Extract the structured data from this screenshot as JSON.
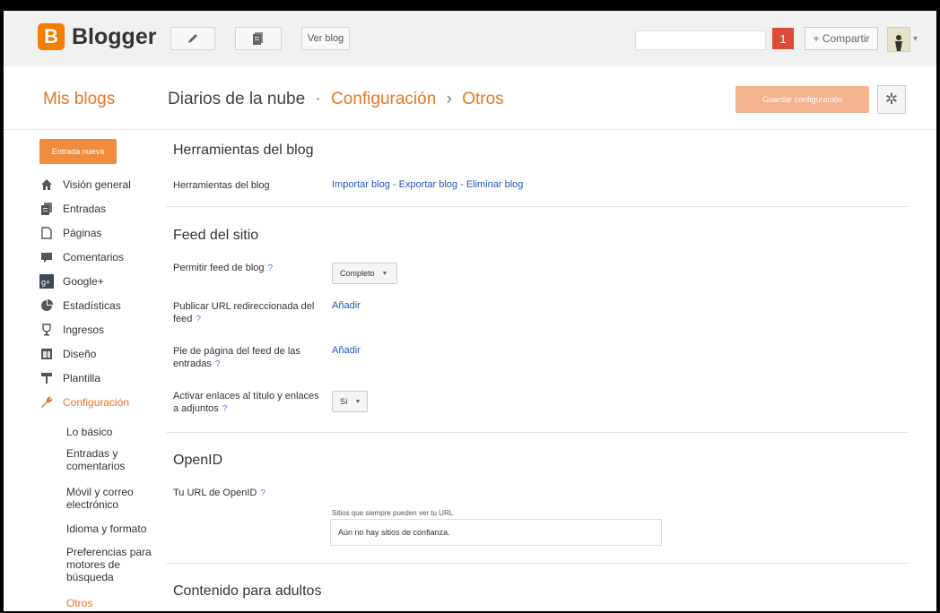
{
  "topbar": {
    "logo_letter": "B",
    "logo_text": "Blogger",
    "edit_icon": "pencil-icon",
    "pages_icon": "pages-icon",
    "view_blog": "Ver blog",
    "notification_count": "1",
    "share_label": "+ Compartir",
    "avatar_icon": "user-avatar-icon"
  },
  "header": {
    "my_blogs": "Mis blogs",
    "blog_name": "Diarios de la nube",
    "dot_sep": "·",
    "section": "Configuración",
    "arrow_sep": "›",
    "subsection": "Otros",
    "save_button": "Guardar configuración",
    "gear_icon": "gear-icon"
  },
  "sidebar": {
    "new_post": "Entrada nueva",
    "items": [
      {
        "label": "Visión general",
        "icon": "home-icon"
      },
      {
        "label": "Entradas",
        "icon": "posts-icon"
      },
      {
        "label": "Páginas",
        "icon": "page-icon"
      },
      {
        "label": "Comentarios",
        "icon": "comment-icon"
      },
      {
        "label": "Google+",
        "icon": "google-plus-icon"
      },
      {
        "label": "Estadísticas",
        "icon": "pie-chart-icon"
      },
      {
        "label": "Ingresos",
        "icon": "trophy-icon"
      },
      {
        "label": "Diseño",
        "icon": "layout-icon"
      },
      {
        "label": "Plantilla",
        "icon": "template-icon"
      },
      {
        "label": "Configuración",
        "icon": "wrench-icon",
        "active": true
      }
    ],
    "subitems": [
      {
        "label": "Lo básico"
      },
      {
        "label": "Entradas y comentarios"
      },
      {
        "label": "Móvil y correo electrónico"
      },
      {
        "label": "Idioma y formato"
      },
      {
        "label": "Preferencias para motores de búsqueda"
      },
      {
        "label": "Otros",
        "active": true
      }
    ]
  },
  "main": {
    "blog_tools": {
      "title": "Herramientas del blog",
      "label": "Herramientas del blog",
      "import": "Importar blog",
      "export": "Exportar blog",
      "delete": "Eliminar blog",
      "sep": " - "
    },
    "site_feed": {
      "title": "Feed del sitio",
      "allow_feed_label": "Permitir feed de blog",
      "allow_feed_value": "Completo",
      "redirect_label": "Publicar URL redireccionada del feed",
      "redirect_action": "Añadir",
      "footer_label": "Pie de página del feed de las entradas",
      "footer_action": "Añadir",
      "enclosure_label": "Activar enlaces al título y enlaces a adjuntos",
      "enclosure_value": "Sí"
    },
    "openid": {
      "title": "OpenID",
      "url_label": "Tu URL de OpenID",
      "trusted_note": "Sitios que siempre pueden ver tu URL",
      "trusted_value": "Aún no hay sitios de confianza."
    },
    "adult": {
      "title": "Contenido para adultos"
    },
    "help_glyph": "?"
  }
}
